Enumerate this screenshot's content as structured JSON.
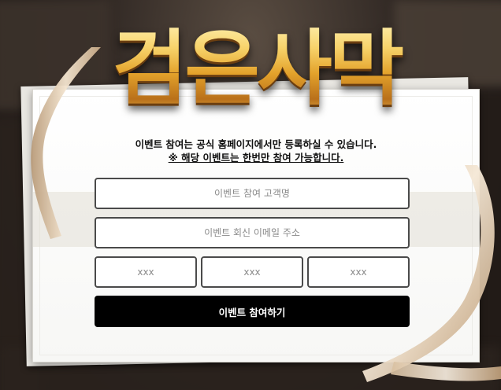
{
  "logo": {
    "title": "검은사막"
  },
  "notice": {
    "line1": "이벤트 참여는 공식 홈페이지에서만 등록하실 수 있습니다.",
    "line2": "※ 해당 이벤트는 한번만 참여 가능합니다."
  },
  "form": {
    "name_placeholder": "이벤트 참여 고객명",
    "email_placeholder": "이벤트 회신 이메일 주소",
    "phone1_placeholder": "xxx",
    "phone2_placeholder": "xxx",
    "phone3_placeholder": "xxx",
    "submit_label": "이벤트 참여하기"
  },
  "colors": {
    "accent_gold": "#e3a22b",
    "button_bg": "#000000",
    "field_border": "#4a4a4a",
    "ribbon": "#e6d2b8"
  }
}
